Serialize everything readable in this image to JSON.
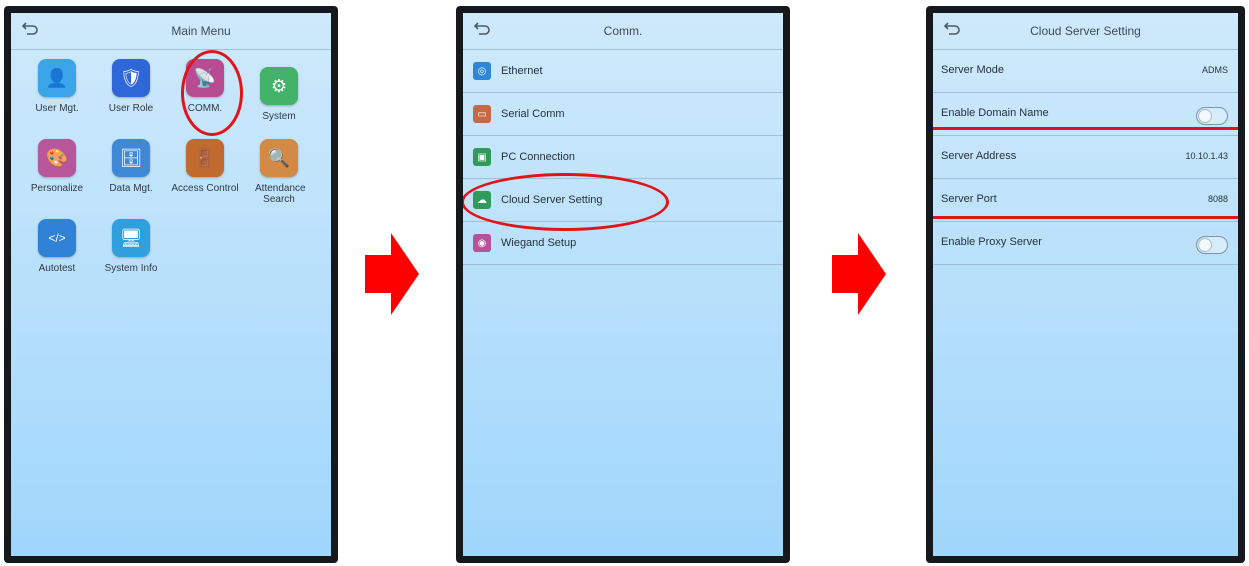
{
  "screens": {
    "main": {
      "title": "Main Menu",
      "tiles": [
        {
          "label": "User Mgt.",
          "icon": "user-mgt-icon"
        },
        {
          "label": "User Role",
          "icon": "user-role-icon"
        },
        {
          "label": "COMM.",
          "icon": "comm-icon"
        },
        {
          "label": "System",
          "icon": "system-gear-icon"
        },
        {
          "label": "Personalize",
          "icon": "personalize-icon"
        },
        {
          "label": "Data Mgt.",
          "icon": "data-mgt-icon"
        },
        {
          "label": "Access Control",
          "icon": "access-control-icon"
        },
        {
          "label": "Attendance Search",
          "icon": "attendance-search-icon"
        },
        {
          "label": "Autotest",
          "icon": "autotest-icon"
        },
        {
          "label": "System Info",
          "icon": "system-info-icon"
        }
      ]
    },
    "comm": {
      "title": "Comm.",
      "items": [
        {
          "label": "Ethernet",
          "icon": "ethernet-icon"
        },
        {
          "label": "Serial Comm",
          "icon": "serial-comm-icon"
        },
        {
          "label": "PC Connection",
          "icon": "pc-connection-icon"
        },
        {
          "label": "Cloud Server Setting",
          "icon": "cloud-server-icon"
        },
        {
          "label": "Wiegand Setup",
          "icon": "wiegand-icon"
        }
      ]
    },
    "cloud": {
      "title": "Cloud Server Setting",
      "rows": [
        {
          "label": "Server Mode",
          "value": "ADMS"
        },
        {
          "label": "Enable Domain Name",
          "value": ""
        },
        {
          "label": "Server Address",
          "value": "10.10.1.43"
        },
        {
          "label": "Server Port",
          "value": "8088"
        },
        {
          "label": "Enable Proxy Server",
          "value": ""
        }
      ]
    }
  },
  "colors": {
    "highlight": "#e2141b",
    "arrow": "#ff0000"
  }
}
